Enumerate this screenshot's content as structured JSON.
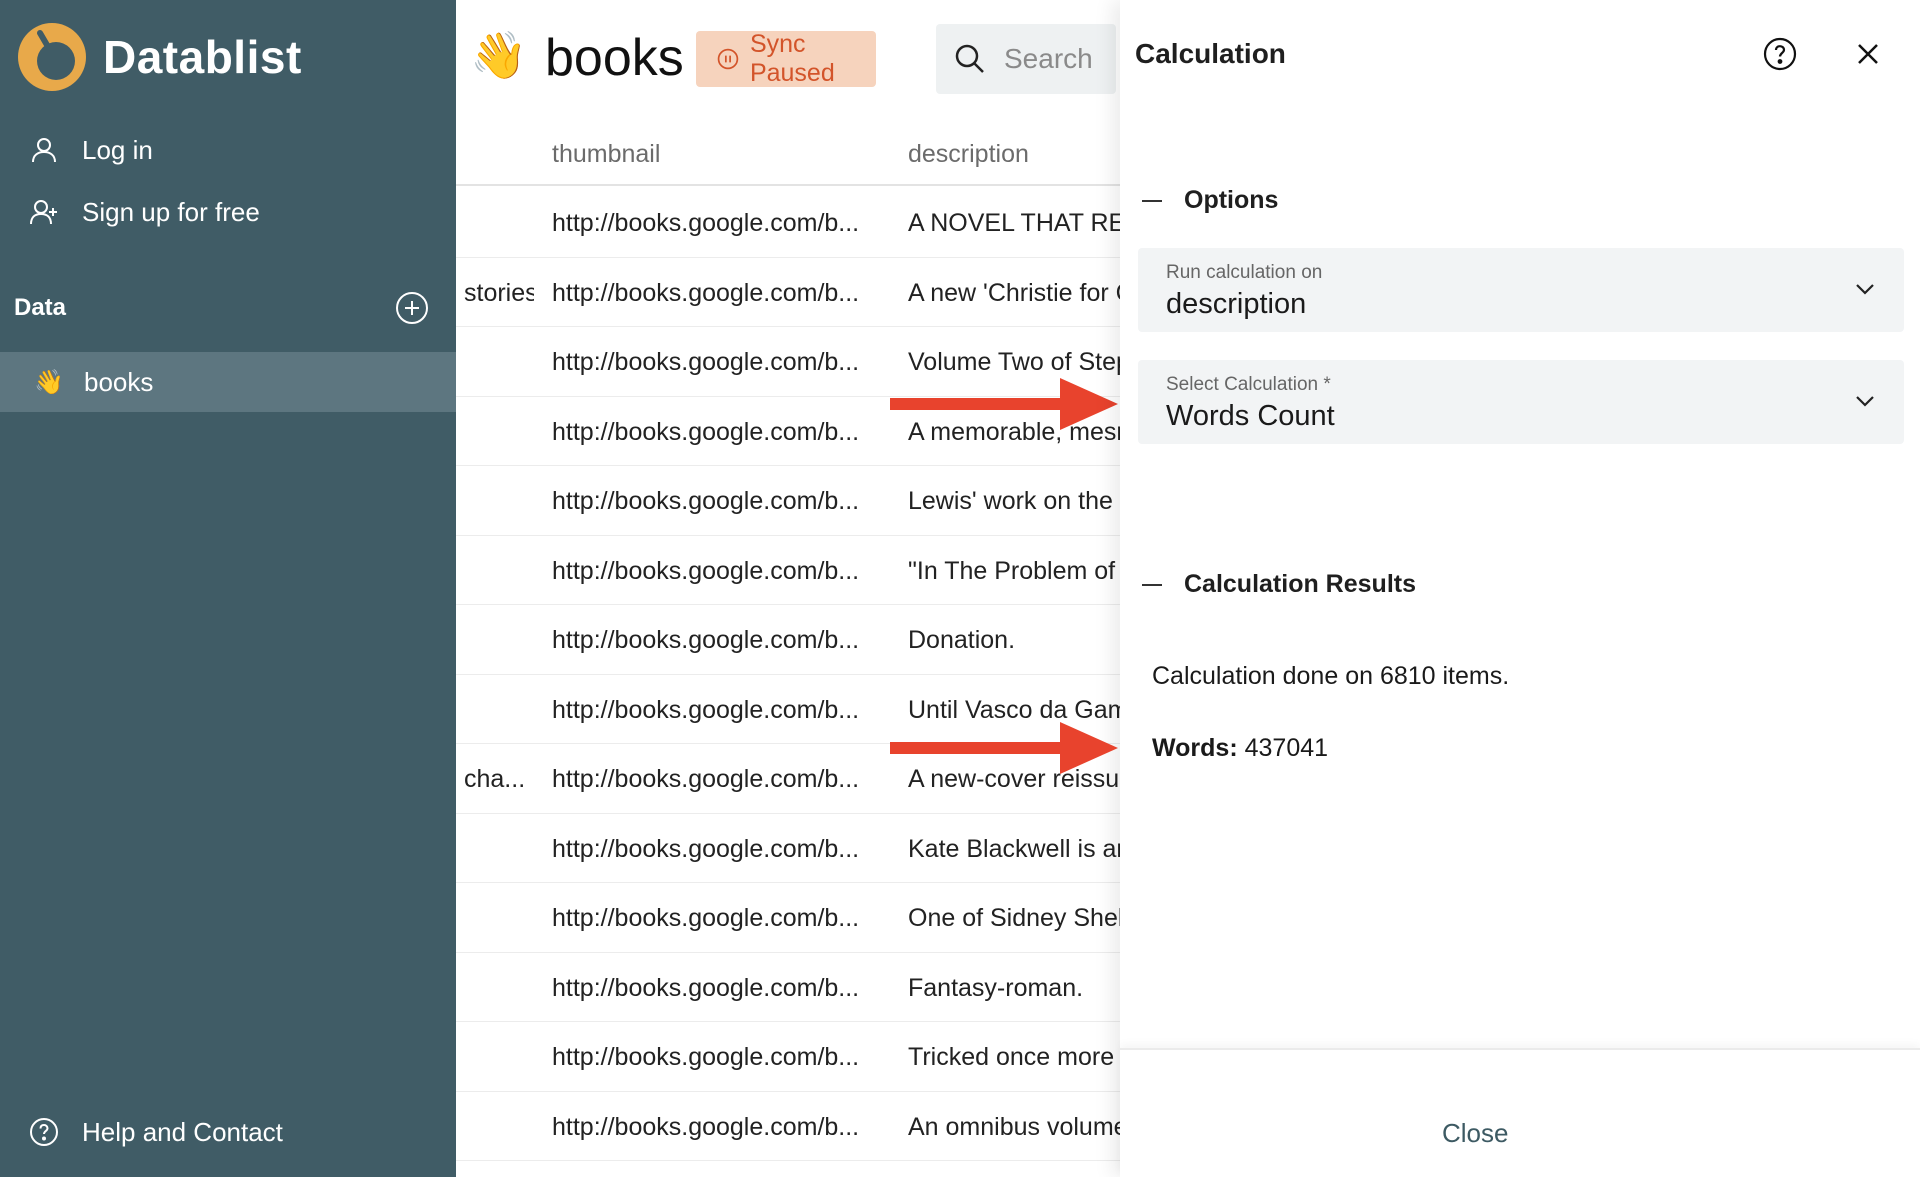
{
  "sidebar": {
    "brand": "Datablist",
    "login": "Log in",
    "signup": "Sign up for free",
    "data_section": "Data",
    "nav_items": [
      {
        "emoji": "👋",
        "label": "books"
      }
    ],
    "help": "Help and Contact"
  },
  "main": {
    "emoji": "👋",
    "title": "books",
    "sync_label": "Sync Paused",
    "search_placeholder": "Search",
    "columns": [
      "thumbnail",
      "description"
    ],
    "rows": [
      {
        "c0": "",
        "thumbnail": "http://books.google.com/b...",
        "description": "A NOVEL THAT REA"
      },
      {
        "c0": "stories",
        "thumbnail": "http://books.google.com/b...",
        "description": "A new 'Christie for C"
      },
      {
        "c0": "",
        "thumbnail": "http://books.google.com/b...",
        "description": "Volume Two of Step"
      },
      {
        "c0": "",
        "thumbnail": "http://books.google.com/b...",
        "description": "A memorable, mesr"
      },
      {
        "c0": "",
        "thumbnail": "http://books.google.com/b...",
        "description": "Lewis' work on the"
      },
      {
        "c0": "",
        "thumbnail": "http://books.google.com/b...",
        "description": "\"In The Problem of"
      },
      {
        "c0": "",
        "thumbnail": "http://books.google.com/b...",
        "description": "Donation."
      },
      {
        "c0": "",
        "thumbnail": "http://books.google.com/b...",
        "description": "Until Vasco da Gam"
      },
      {
        "c0": "cha...",
        "thumbnail": "http://books.google.com/b...",
        "description": "A new-cover reissue"
      },
      {
        "c0": "",
        "thumbnail": "http://books.google.com/b...",
        "description": "Kate Blackwell is an"
      },
      {
        "c0": "",
        "thumbnail": "http://books.google.com/b...",
        "description": "One of Sidney Shelc"
      },
      {
        "c0": "",
        "thumbnail": "http://books.google.com/b...",
        "description": "Fantasy-roman."
      },
      {
        "c0": "",
        "thumbnail": "http://books.google.com/b...",
        "description": "Tricked once more"
      },
      {
        "c0": "",
        "thumbnail": "http://books.google.com/b...",
        "description": "An omnibus volume"
      }
    ]
  },
  "panel": {
    "title": "Calculation",
    "options_label": "Options",
    "run_on_label": "Run calculation on",
    "run_on_value": "description",
    "select_label": "Select Calculation *",
    "select_value": "Words Count",
    "results_label": "Calculation Results",
    "result_text": "Calculation done on 6810 items.",
    "words_label": "Words:",
    "words_value": "437041",
    "close_label": "Close"
  },
  "colors": {
    "sidebar_bg": "#405c66",
    "sidebar_active": "#5d7680",
    "sync_bg": "#f6d3bd",
    "sync_text": "#d3542a",
    "annotation_arrow": "#e8432d"
  }
}
